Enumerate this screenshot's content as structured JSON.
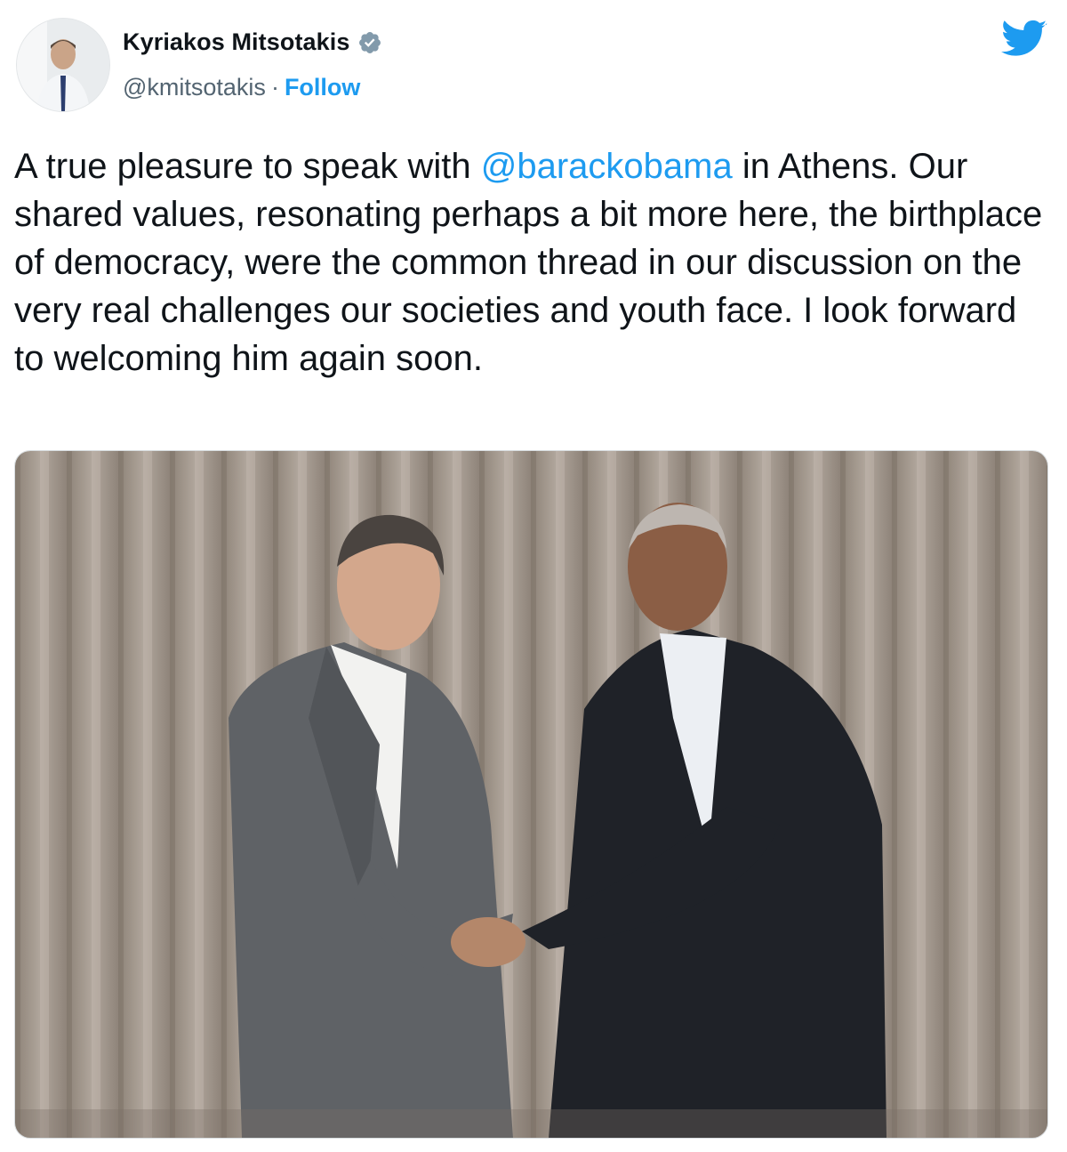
{
  "author": {
    "name": "Kyriakos Mitsotakis",
    "handle": "@kmitsotakis",
    "separator": "·",
    "follow_label": "Follow",
    "verified_icon": "verified-badge-icon"
  },
  "platform_icon": "twitter-bird-icon",
  "tweet": {
    "text_before": "A true pleasure to speak with ",
    "mention": "@barackobama",
    "text_after": " in Athens. Our shared values, resonating perhaps a bit more here, the birthplace of democracy, were the common thread in our discussion on the very real challenges our societies and youth face. I look forward to welcoming him again soon."
  },
  "colors": {
    "accent": "#1d9bf0",
    "text": "#0f1419",
    "secondary": "#536471"
  }
}
